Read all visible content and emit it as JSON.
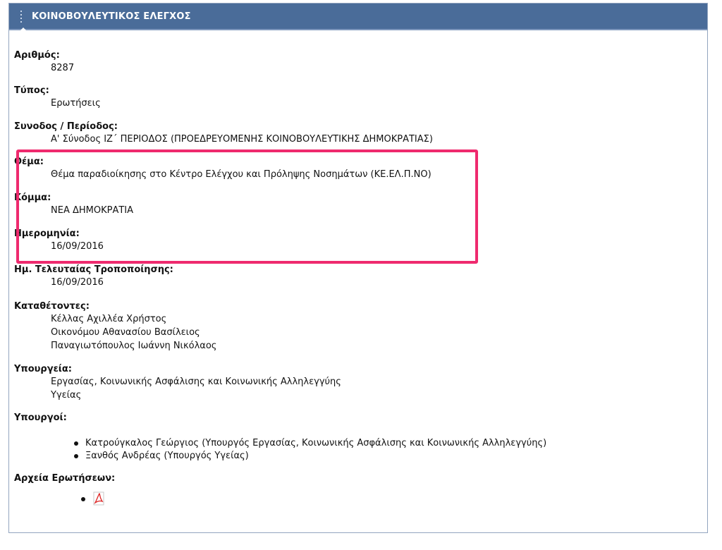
{
  "header": {
    "title": "ΚΟΙΝΟΒΟΥΛΕΥΤΙΚΟΣ ΕΛΕΓΧΟΣ"
  },
  "fields": {
    "number": {
      "label": "Αριθμός:",
      "value": "8287"
    },
    "type": {
      "label": "Τύπος:",
      "value": "Ερωτήσεις"
    },
    "session": {
      "label": "Συνοδος / Περίοδος:",
      "value": "Α' Σύνοδος ΙΖ΄ ΠΕΡΙΟΔΟΣ (ΠΡΟΕΔΡΕΥΟΜΕΝΗΣ ΚΟΙΝΟΒΟΥΛΕΥΤΙΚΗΣ ΔΗΜΟΚΡΑΤΙΑΣ)"
    },
    "subject": {
      "label": "Θέμα:",
      "value": "Θέμα παραδιοίκησης στο Κέντρο Ελέγχου και Πρόληψης Νοσημάτων (ΚΕ.ΕΛ.Π.ΝΟ)"
    },
    "party": {
      "label": "Κόμμα:",
      "value": "ΝΕΑ ΔΗΜΟΚΡΑΤΙΑ"
    },
    "date": {
      "label": "Ημερομηνία:",
      "value": "16/09/2016"
    },
    "last_modified": {
      "label": "Ημ. Τελευταίας Τροποποίησης:",
      "value": "16/09/2016"
    },
    "submitters": {
      "label": "Καταθέτοντες:",
      "values": [
        "Κέλλας Αχιλλέα Χρήστος",
        "Οικονόμου Αθανασίου Βασίλειος",
        "Παναγιωτόπουλος Ιωάννη Νικόλαος"
      ]
    },
    "ministries": {
      "label": "Υπουργεία:",
      "values": [
        "Εργασίας, Κοινωνικής Ασφάλισης και Κοινωνικής Αλληλεγγύης",
        "Υγείας"
      ]
    },
    "ministers": {
      "label": "Υπουργοί:",
      "values": [
        "Κατρούγκαλος Γεώργιος (Υπουργός Εργασίας, Κοινωνικής Ασφάλισης και Κοινωνικής Αλληλεγγύης)",
        "Ξανθός Ανδρέας (Υπουργός Υγείας)"
      ]
    },
    "files": {
      "label": "Αρχεία Ερωτήσεων:",
      "icon": "pdf-icon"
    }
  },
  "highlight": {
    "color": "#ef2a6e"
  },
  "colors": {
    "header_bg": "#4a6c99",
    "frame_border": "#93a5bf"
  }
}
